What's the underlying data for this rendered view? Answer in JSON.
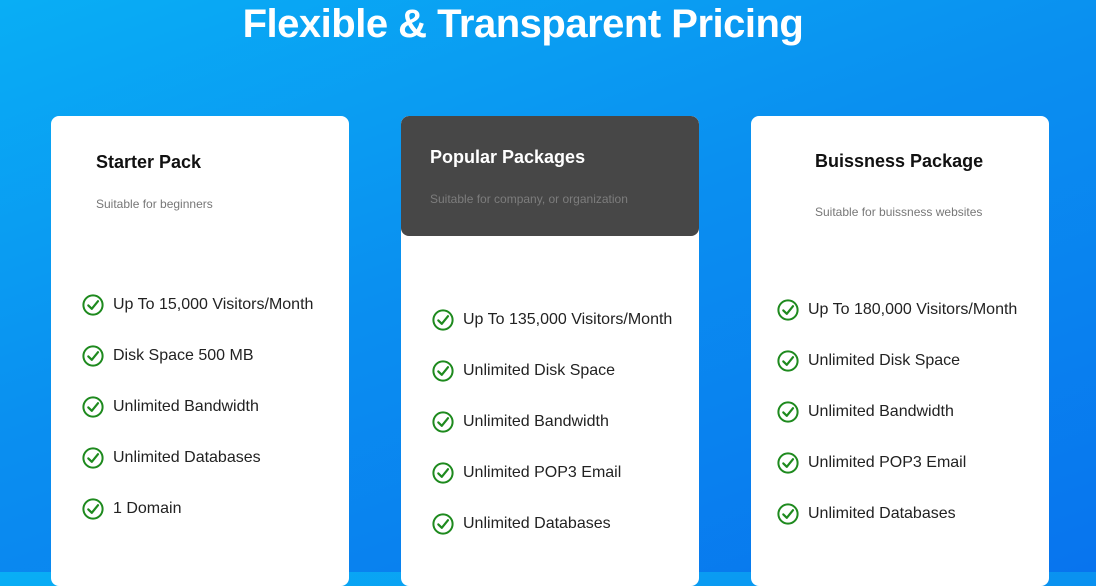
{
  "heading": "Flexible & Transparent Pricing",
  "colors": {
    "background_start": "#09aef5",
    "background_end": "#0874ee",
    "check_green": "#1e8a1e",
    "featured_header": "#474747"
  },
  "cards": [
    {
      "title": "Starter Pack",
      "subtitle": "Suitable for beginners",
      "features": [
        "Up To 15,000 Visitors/Month",
        "Disk Space 500 MB",
        "Unlimited Bandwidth",
        "Unlimited Databases",
        "1 Domain"
      ]
    },
    {
      "title": "Popular Packages",
      "subtitle": "Suitable for company, or organization",
      "features": [
        "Up To 135,000 Visitors/Month",
        "Unlimited Disk Space",
        "Unlimited Bandwidth",
        "Unlimited POP3 Email",
        "Unlimited Databases"
      ]
    },
    {
      "title": "Buissness Package",
      "subtitle": "Suitable for buissness websites",
      "features": [
        "Up To 180,000 Visitors/Month",
        "Unlimited Disk Space",
        "Unlimited Bandwidth",
        "Unlimited POP3 Email",
        "Unlimited Databases"
      ]
    }
  ],
  "icons": {
    "feature_icon": "check-circle-icon"
  }
}
